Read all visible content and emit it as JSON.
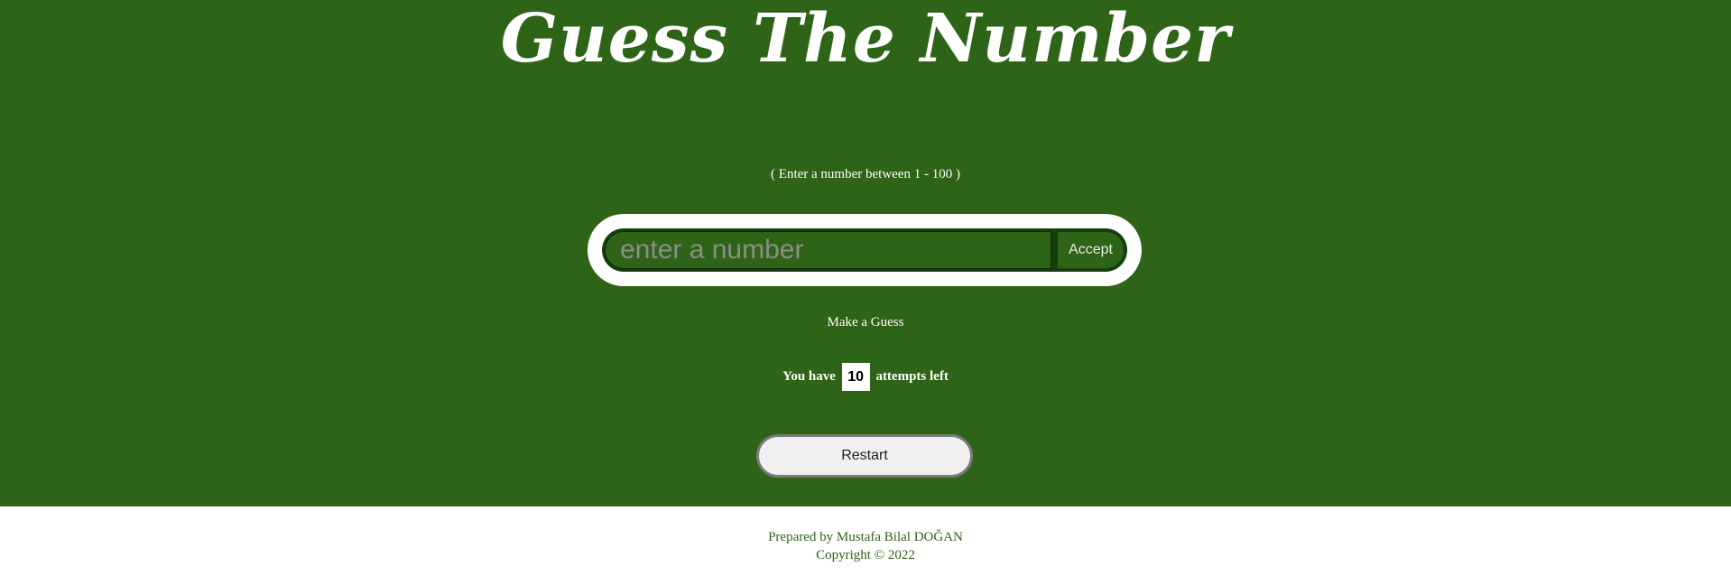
{
  "header": {
    "title": "Guess The Number"
  },
  "game": {
    "hint": "( Enter a number between 1 - 100 )",
    "input_placeholder": "enter a number",
    "accept_label": "Accept",
    "message": "Make a Guess",
    "attempts_prefix": "You have",
    "attempts_count": "10",
    "attempts_suffix": "attempts left",
    "restart_label": "Restart"
  },
  "footer": {
    "prepared_by": "Prepared by Mustafa Bilal DOĞAN",
    "copyright": "Copyright © 2022"
  },
  "colors": {
    "background": "#2e6417",
    "pill": "#ffffff",
    "input_ring": "#173f0d"
  }
}
